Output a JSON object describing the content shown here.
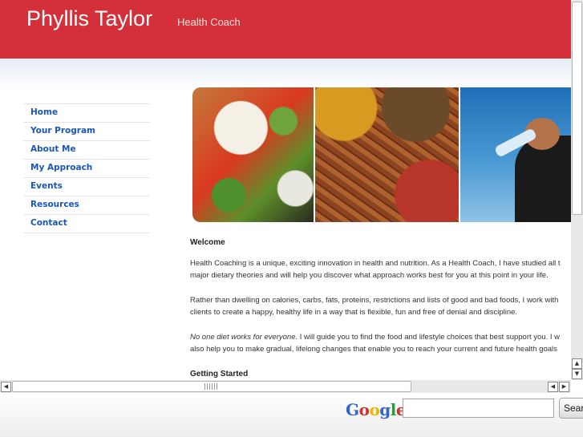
{
  "header": {
    "site_title": "Phyllis Taylor",
    "tagline": "Health Coach"
  },
  "nav": [
    "Home",
    "Your Program",
    "About Me",
    "My Approach",
    "Events",
    "Resources",
    "Contact"
  ],
  "content": {
    "welcome_heading": "Welcome",
    "para1_line1": "Health Coaching is a unique, exciting innovation in health and nutrition. As a Health Coach, I have studied all t",
    "para1_line2": "major dietary theories and will help you discover what approach works best for you at this point in your life.",
    "para2_line1": "Rather than dwelling on calories, carbs, fats, proteins, restrictions and lists of good and bad foods, I work with",
    "para2_line2": "clients to create a happy, healthy life in a way that is flexible, fun and free of denial and discipline.",
    "para3_em": "No one diet works for everyone.",
    "para3_rest": " I will guide you to find the food and lifestyle choices that best support you. I w",
    "para3_line2": "also help you to make gradual, lifelong changes that enable you to reach your current and future health goals",
    "getting_started_heading": "Getting Started"
  },
  "scrollbars": {
    "up": "▲",
    "down": "▼",
    "left": "◀",
    "right": "▶"
  },
  "search": {
    "logo_letters": [
      "G",
      "o",
      "o",
      "g",
      "l",
      "e"
    ],
    "logo_dash": "-",
    "button_label": "Search",
    "input_value": ""
  },
  "colors": {
    "header_red": "#d4303a",
    "nav_link": "#1a56b8"
  }
}
